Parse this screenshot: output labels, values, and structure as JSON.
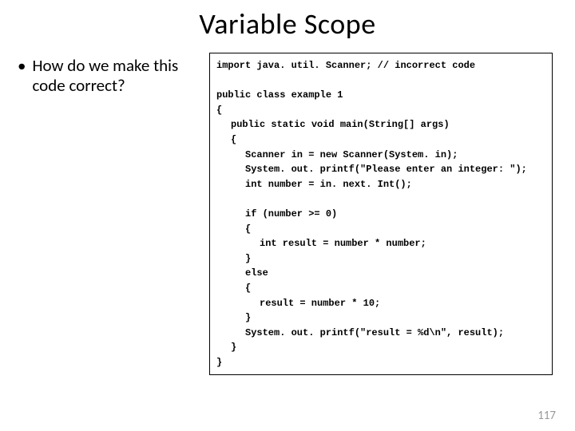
{
  "title": "Variable Scope",
  "bullet_text": "How do we make this code correct?",
  "code": {
    "l1": "import java. util. Scanner; // incorrect code",
    "l2": "public class example 1",
    "l3": "{",
    "l4": "public static void main(String[] args)",
    "l5": "{",
    "l6": "Scanner in = new Scanner(System. in);",
    "l7": "System. out. printf(\"Please enter an integer: \");",
    "l8": "int number = in. next. Int();",
    "l9": "if (number >= 0)",
    "l10": "{",
    "l11": "int result = number * number;",
    "l12": "}",
    "l13": "else",
    "l14": "{",
    "l15": "result = number * 10;",
    "l16": "}",
    "l17": "System. out. printf(\"result = %d\\n\", result);",
    "l18": "}",
    "l19": "}"
  },
  "page_number": "117"
}
